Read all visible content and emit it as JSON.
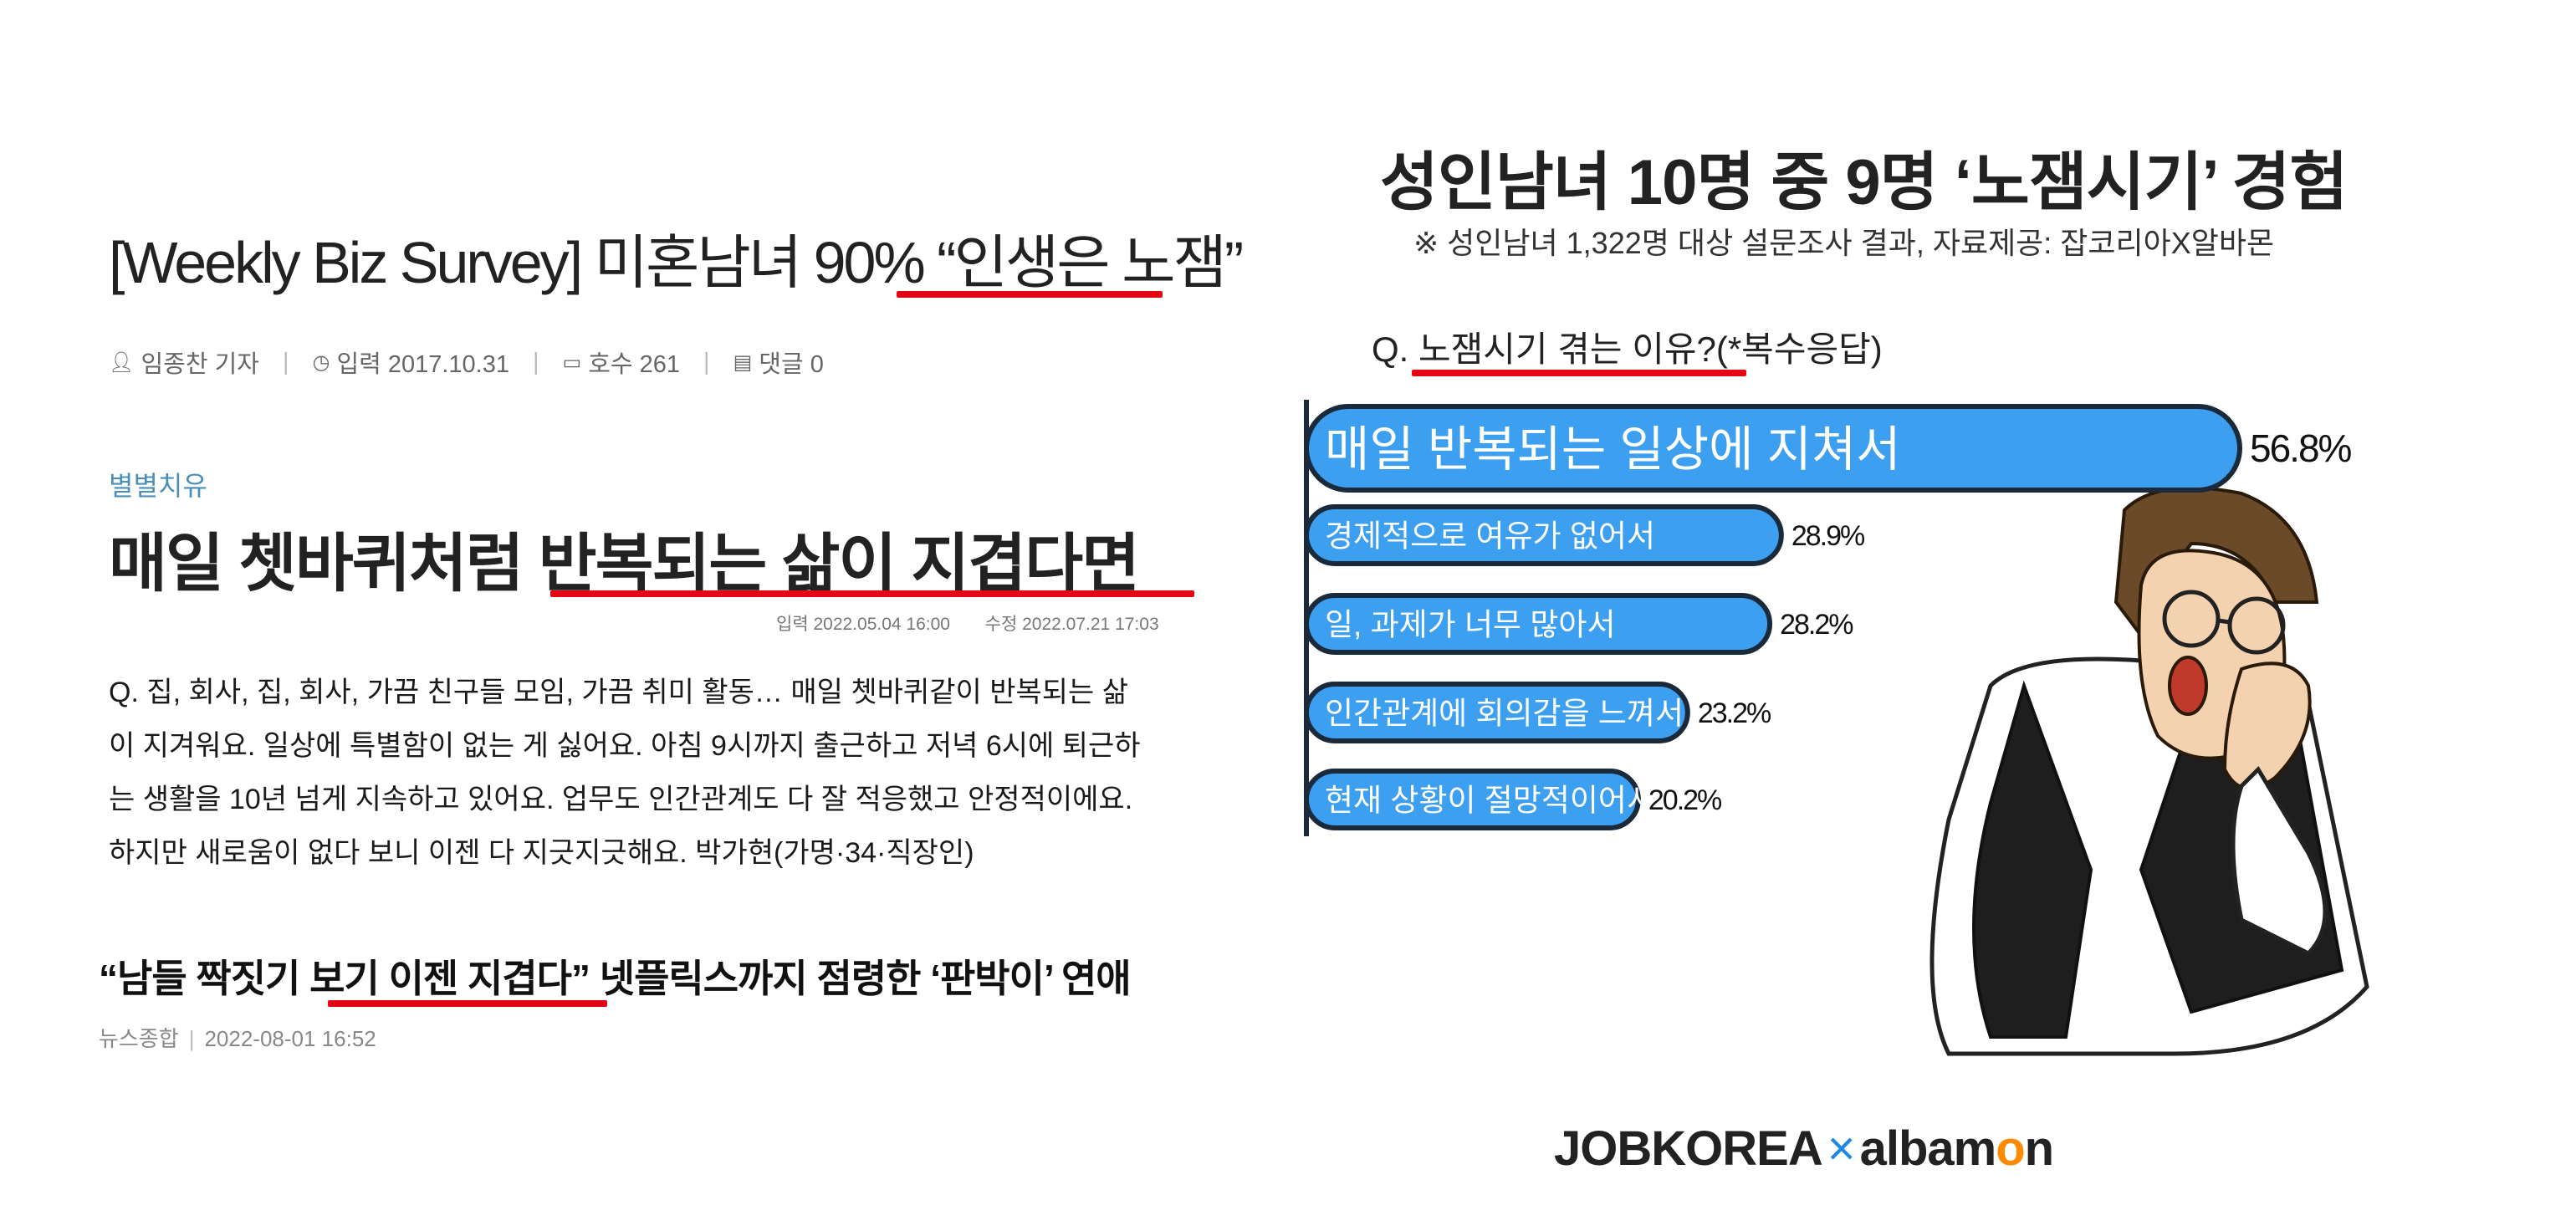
{
  "article1": {
    "title_prefix": "[Weekly Biz Survey] 미혼남녀 90% ",
    "title_highlight": "“인생은 노잼”",
    "author": "임종찬 기자",
    "date": "입력 2017.10.31",
    "issue": "호수 261",
    "comments": "댓글 0"
  },
  "article2": {
    "category": "별별치유",
    "title_prefix": "매일 쳇바퀴처럼 ",
    "title_highlight": "반복되는 삶이 지겹다면",
    "input_date": "입력  2022.05.04 16:00",
    "edit_date": "수정  2022.07.21 17:03",
    "body_lines": [
      "Q. 집, 회사, 집, 회사, 가끔 친구들 모임, 가끔 취미 활동… 매일 쳇바퀴같이 반복되는 삶",
      "이 지겨워요. 일상에 특별함이 없는 게 싫어요. 아침 9시까지 출근하고 저녁 6시에 퇴근하",
      "는 생활을 10년 넘게 지속하고 있어요. 업무도 인간관계도 다 잘 적응했고 안정적이에요.",
      "하지만 새로움이 없다 보니 이젠 다 지긋지긋해요. 박가현(가명·34·직장인)"
    ]
  },
  "article3": {
    "title_a": "“남들 짝짓기 ",
    "title_highlight": "보기 이젠 지겹다",
    "title_b": "” 넷플릭스까지 점령한 ‘판박이’ 연애",
    "source": "뉴스종합",
    "datetime": "2022-08-01 16:52"
  },
  "chart": {
    "title": "성인남녀 10명 중 9명 ‘노잼시기’ 경험",
    "subtitle": "※ 성인남녀 1,322명 대상 설문조사 결과,  자료제공: 잡코리아X알바몬",
    "question_prefix": "Q. ",
    "question_highlight": "노잼시기 겪는 이유?",
    "question_suffix": "(*복수응답)",
    "logo_a": "JOBKOREA",
    "logo_x": "×",
    "logo_b1": "albam",
    "logo_o": "o",
    "logo_b2": "n"
  },
  "chart_data": {
    "type": "bar",
    "orientation": "horizontal",
    "title": "성인남녀 10명 중 9명 ‘노잼시기’ 경험",
    "categories": [
      "매일 반복되는 일상에 지쳐서",
      "경제적으로 여유가 없어서",
      "일, 과제가 너무 많아서",
      "인간관계에 회의감을 느껴서",
      "현재 상황이 절망적이어서"
    ],
    "values": [
      56.8,
      28.9,
      28.2,
      23.2,
      20.2
    ],
    "value_labels": [
      "56.8%",
      "28.9%",
      "28.2%",
      "23.2%",
      "20.2%"
    ],
    "unit": "%",
    "colors": {
      "bar": "#3d9ff0",
      "outline": "#1a2a3a",
      "highlight_underline": "#e30613"
    }
  }
}
